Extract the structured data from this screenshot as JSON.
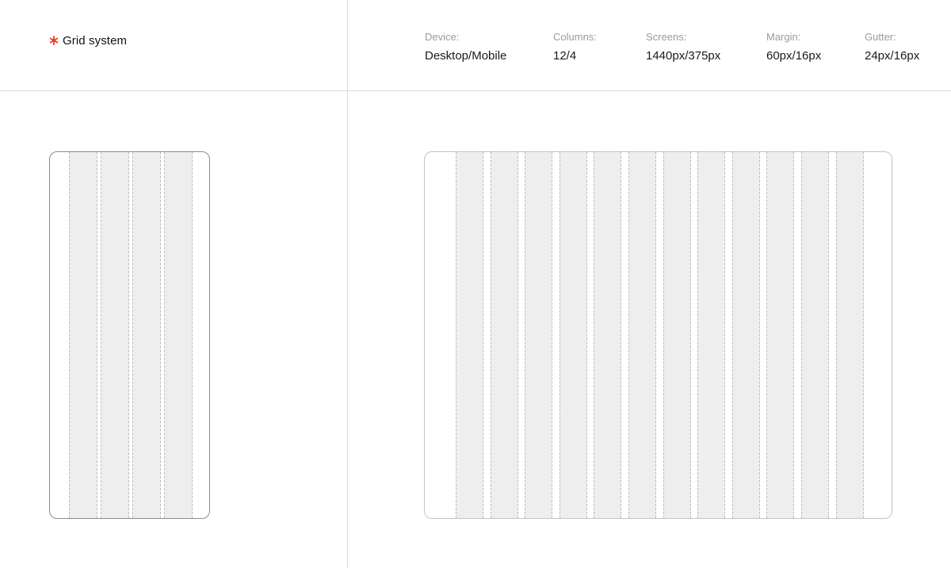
{
  "header": {
    "title": "Grid system",
    "title_icon": "asterisk-icon",
    "accent_color": "#e8371f"
  },
  "specs": [
    {
      "label": "Device:",
      "value": "Desktop/Mobile"
    },
    {
      "label": "Columns:",
      "value": "12/4"
    },
    {
      "label": "Screens:",
      "value": "1440px/375px"
    },
    {
      "label": "Margin:",
      "value": "60px/16px"
    },
    {
      "label": "Gutter:",
      "value": "24px/16px"
    }
  ],
  "grids": {
    "mobile": {
      "columns": 4
    },
    "desktop": {
      "columns": 12
    }
  },
  "colors": {
    "column_fill": "#eeeeee",
    "column_guide": "#bdbdbd",
    "divider": "#dcdcdc"
  }
}
